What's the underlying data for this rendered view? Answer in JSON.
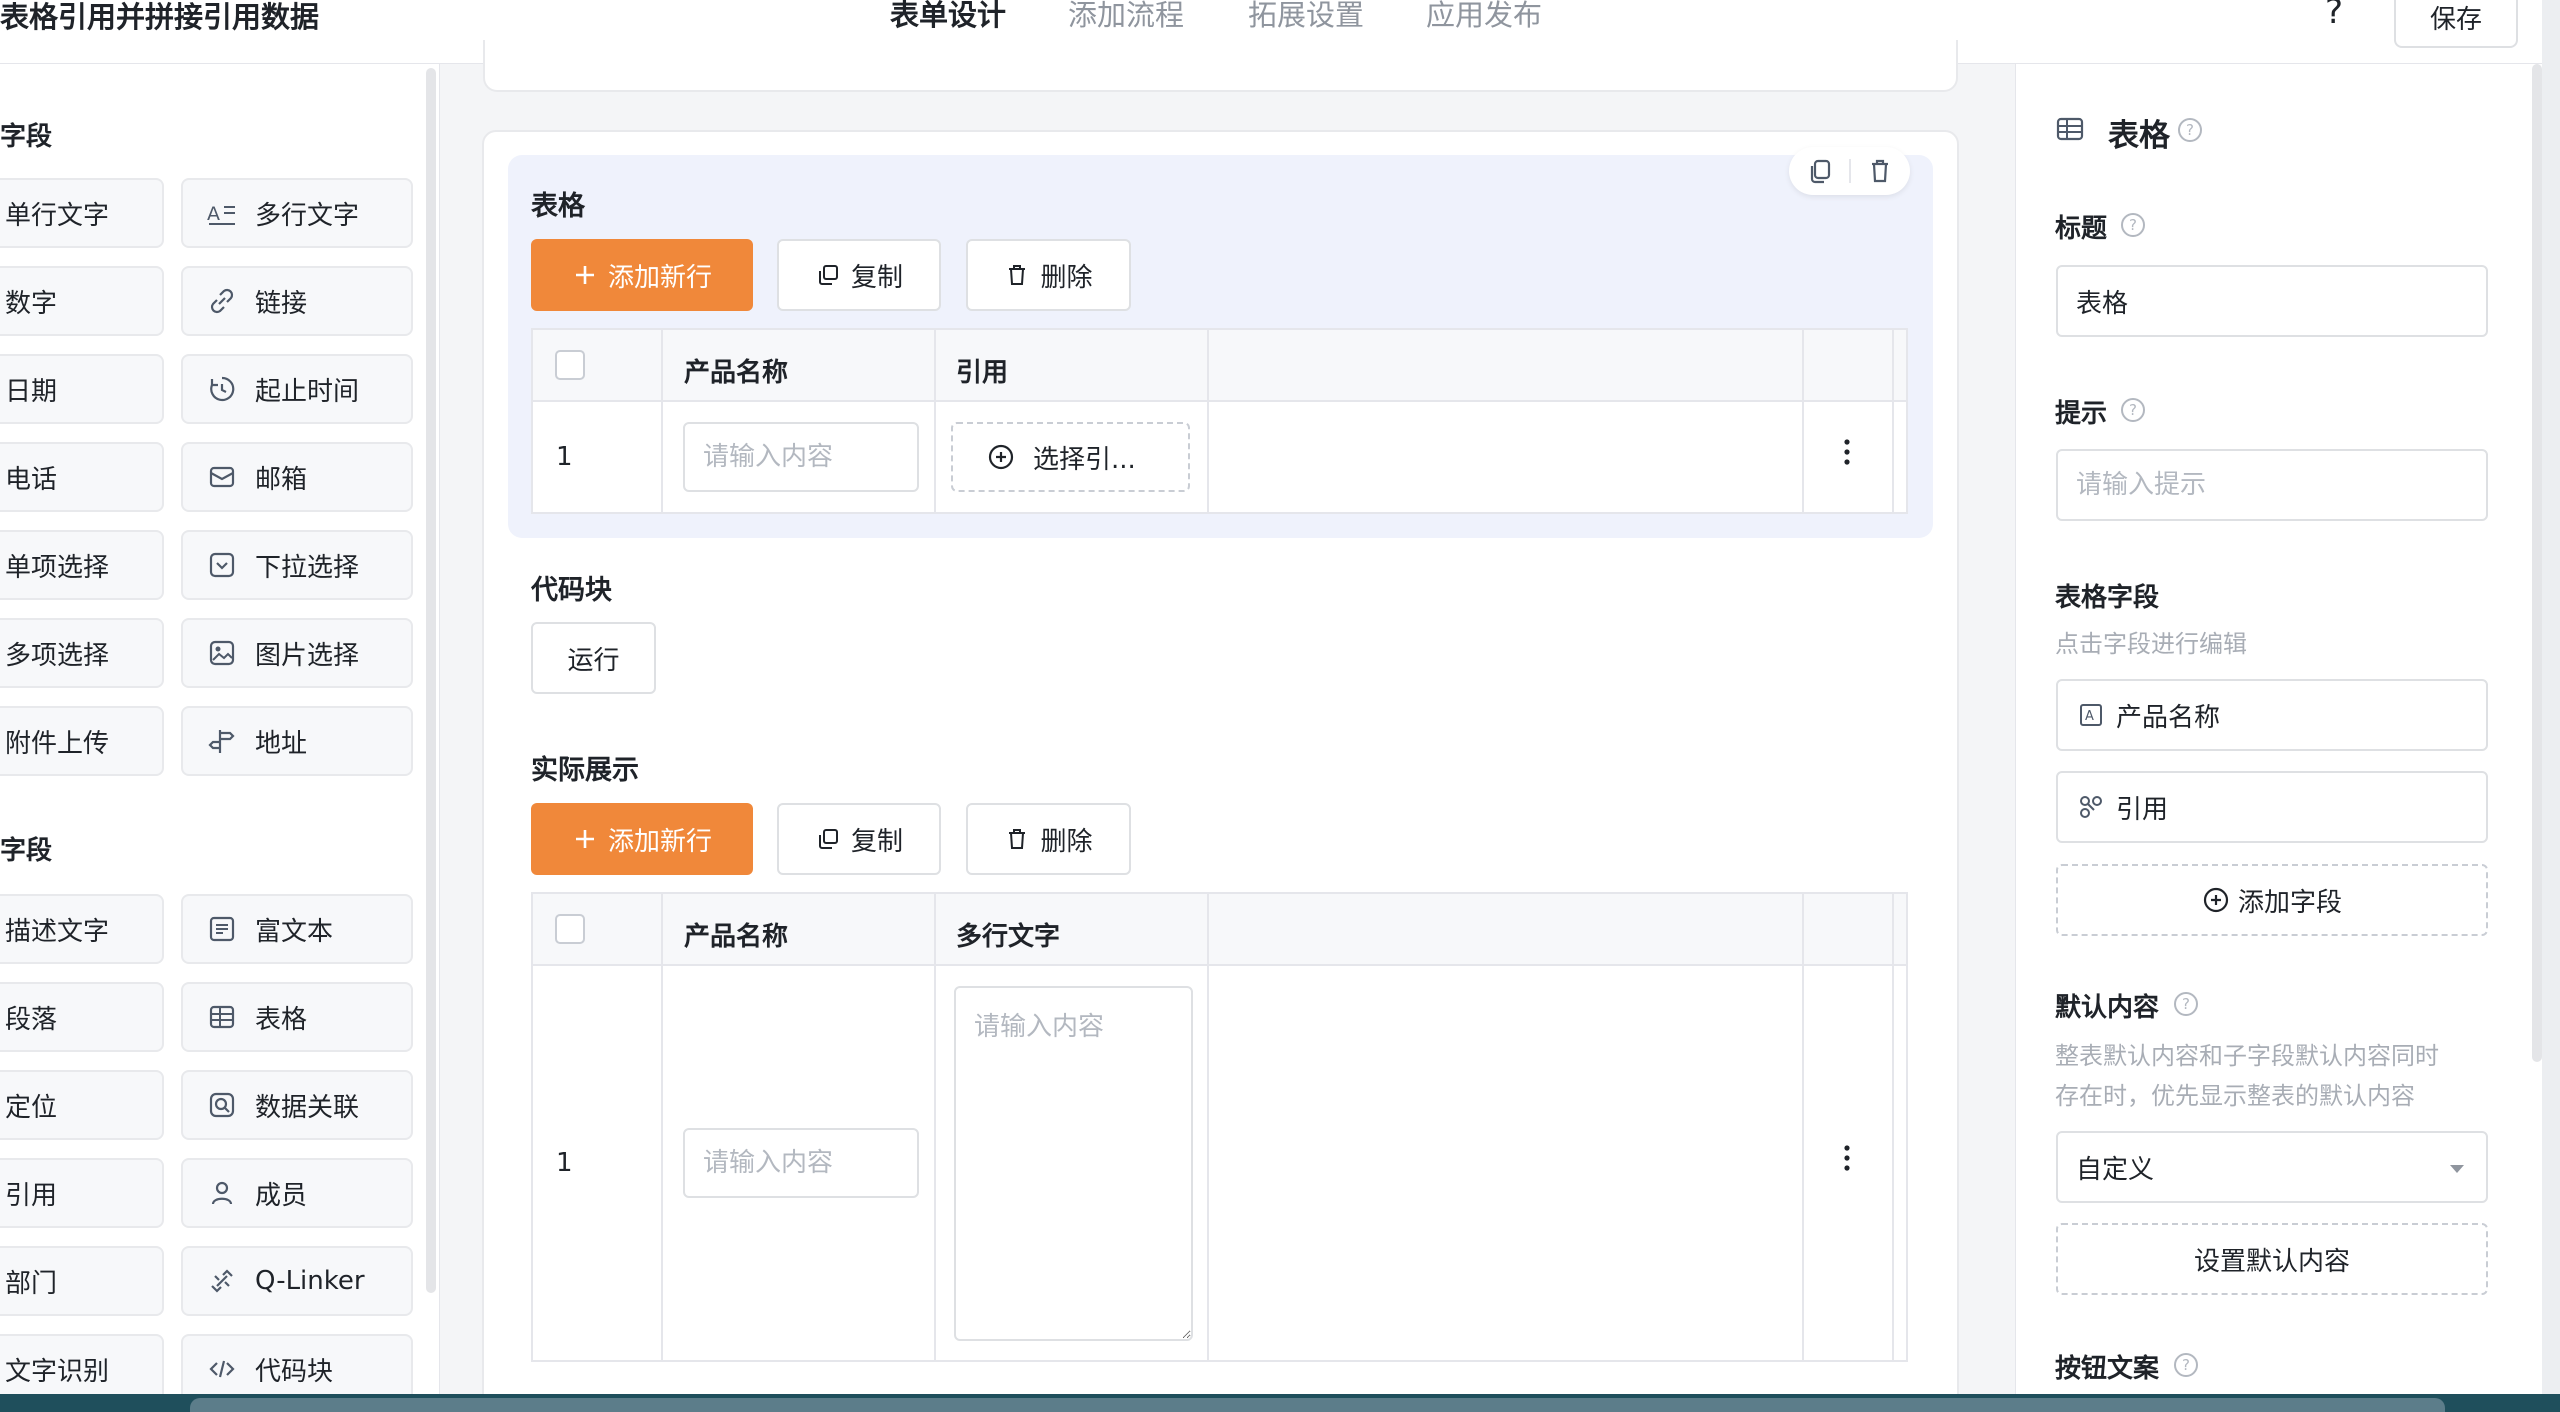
{
  "app": {
    "title": "表格引用并拼接引用数据",
    "tabs": [
      "表单设计",
      "添加流程",
      "拓展设置",
      "应用发布"
    ],
    "active_tab": "表单设计",
    "help_label": "?",
    "save_label": "保存",
    "accent_color": "#f0883a"
  },
  "left_panel": {
    "group1_title": "字段",
    "group2_title": "字段",
    "fields_group1": [
      {
        "label": "单行文字",
        "icon": "text-line-icon"
      },
      {
        "label": "多行文字",
        "icon": "multiline-text-icon"
      },
      {
        "label": "数字",
        "icon": "number-icon"
      },
      {
        "label": "链接",
        "icon": "link-icon"
      },
      {
        "label": "日期",
        "icon": "calendar-icon"
      },
      {
        "label": "起止时间",
        "icon": "time-range-icon"
      },
      {
        "label": "电话",
        "icon": "phone-icon"
      },
      {
        "label": "邮箱",
        "icon": "mail-icon"
      },
      {
        "label": "单项选择",
        "icon": "radio-icon"
      },
      {
        "label": "下拉选择",
        "icon": "dropdown-icon"
      },
      {
        "label": "多项选择",
        "icon": "checkbox-icon"
      },
      {
        "label": "图片选择",
        "icon": "image-icon"
      },
      {
        "label": "附件上传",
        "icon": "attachment-icon"
      },
      {
        "label": "地址",
        "icon": "signpost-icon"
      }
    ],
    "fields_group2": [
      {
        "label": "描述文字",
        "icon": "description-icon"
      },
      {
        "label": "富文本",
        "icon": "rich-text-icon"
      },
      {
        "label": "段落",
        "icon": "paragraph-icon"
      },
      {
        "label": "表格",
        "icon": "table-icon"
      },
      {
        "label": "定位",
        "icon": "location-icon"
      },
      {
        "label": "数据关联",
        "icon": "data-link-icon"
      },
      {
        "label": "引用",
        "icon": "quote-icon"
      },
      {
        "label": "成员",
        "icon": "member-icon"
      },
      {
        "label": "部门",
        "icon": "department-icon"
      },
      {
        "label": "Q-Linker",
        "icon": "q-linker-icon"
      },
      {
        "label": "文字识别",
        "icon": "ocr-icon"
      },
      {
        "label": "代码块",
        "icon": "code-icon"
      }
    ]
  },
  "canvas": {
    "table_block": {
      "label": "表格",
      "add_row_label": "添加新行",
      "copy_label": "复制",
      "delete_label": "删除",
      "columns": [
        "产品名称",
        "引用"
      ],
      "row_number": "1",
      "input_placeholder": "请输入内容",
      "select_ref_label": "选择引..."
    },
    "code_block": {
      "label": "代码块",
      "run_label": "运行"
    },
    "display_block": {
      "label": "实际展示",
      "add_row_label": "添加新行",
      "copy_label": "复制",
      "delete_label": "删除",
      "columns": [
        "产品名称",
        "多行文字"
      ],
      "row_number": "1",
      "input_placeholder": "请输入内容",
      "textarea_placeholder": "请输入内容"
    }
  },
  "right_panel": {
    "title": "表格",
    "title_label": "标题",
    "title_value": "表格",
    "hint_label": "提示",
    "hint_placeholder": "请输入提示",
    "table_fields_label": "表格字段",
    "table_fields_hint": "点击字段进行编辑",
    "table_fields": [
      {
        "label": "产品名称",
        "icon": "text-field-icon"
      },
      {
        "label": "引用",
        "icon": "quote-icon"
      }
    ],
    "add_field_label": "添加字段",
    "default_label": "默认内容",
    "default_hint_line1": "整表默认内容和子字段默认内容同时",
    "default_hint_line2": "存在时，优先显示整表的默认内容",
    "default_select_value": "自定义",
    "set_default_label": "设置默认内容",
    "button_text_label": "按钮文案"
  }
}
